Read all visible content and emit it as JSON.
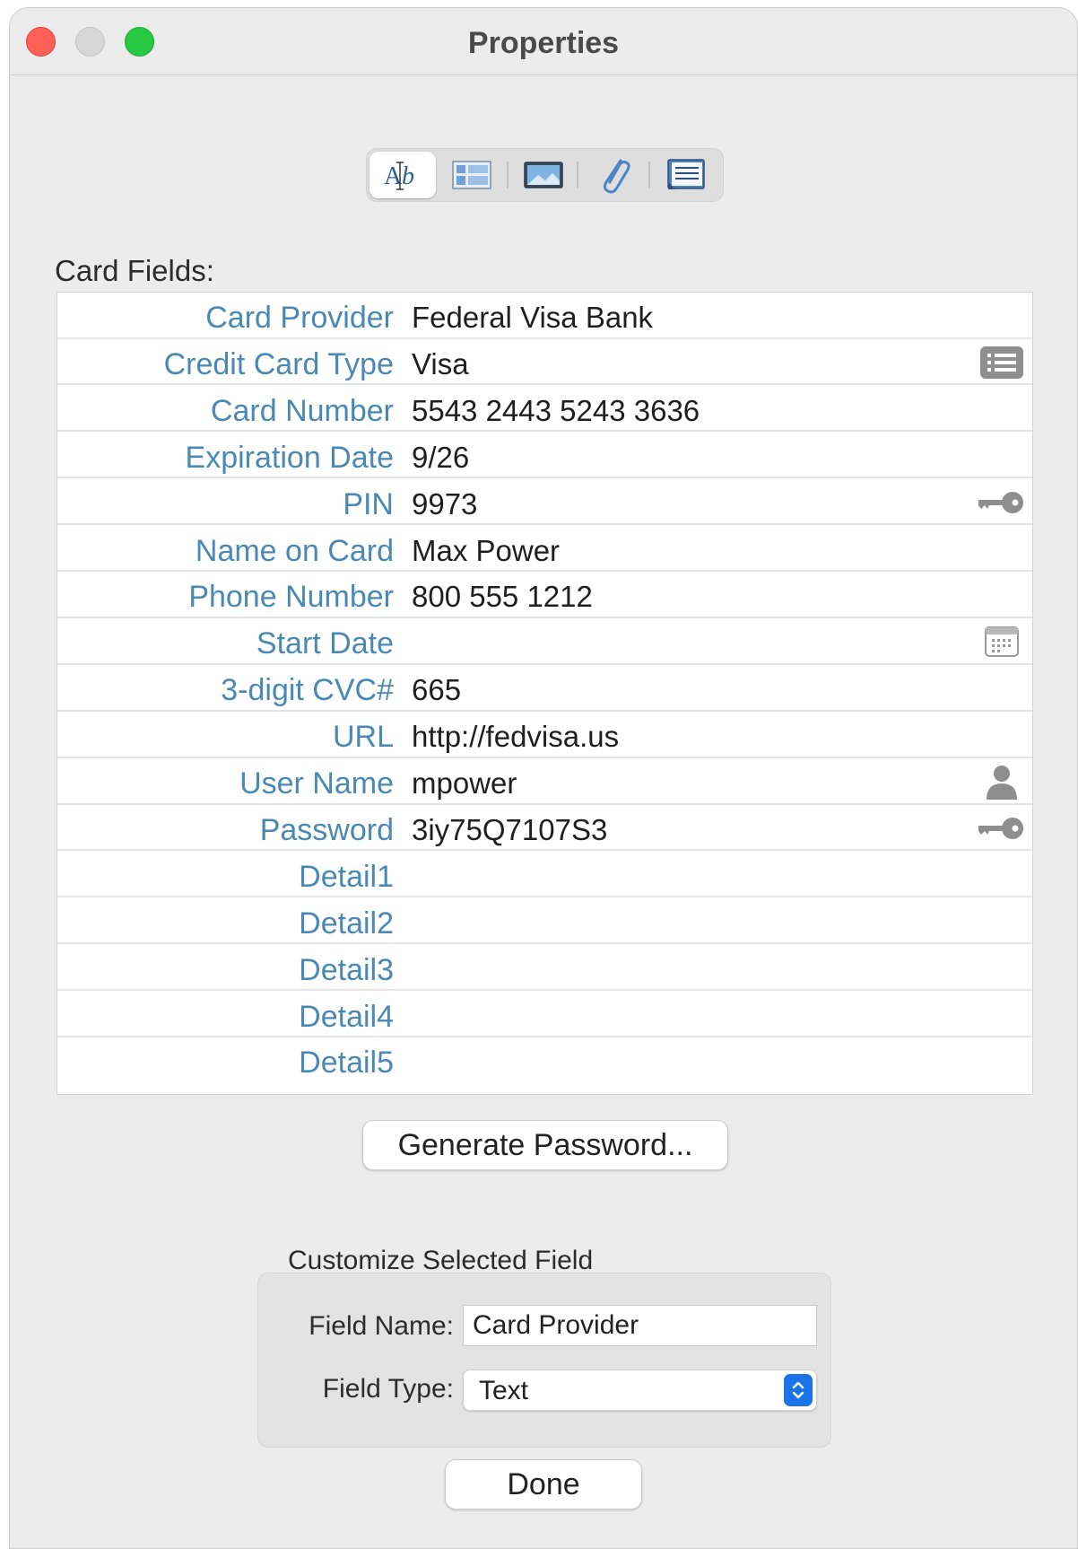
{
  "window": {
    "title": "Properties"
  },
  "section_label": "Card Fields:",
  "fields": [
    {
      "name": "Card Provider",
      "value": "Federal Visa Bank",
      "icon": ""
    },
    {
      "name": "Credit Card Type",
      "value": "Visa",
      "icon": "list-icon"
    },
    {
      "name": "Card Number",
      "value": "5543 2443 5243 3636",
      "icon": ""
    },
    {
      "name": "Expiration Date",
      "value": "9/26",
      "icon": ""
    },
    {
      "name": "PIN",
      "value": "9973",
      "icon": "key-icon"
    },
    {
      "name": "Name on Card",
      "value": "Max Power",
      "icon": ""
    },
    {
      "name": "Phone Number",
      "value": "800 555 1212",
      "icon": ""
    },
    {
      "name": "Start Date",
      "value": "",
      "icon": "calendar-icon"
    },
    {
      "name": "3-digit CVC#",
      "value": "665",
      "icon": ""
    },
    {
      "name": "URL",
      "value": "http://fedvisa.us",
      "icon": ""
    },
    {
      "name": "User Name",
      "value": "mpower",
      "icon": "person-icon"
    },
    {
      "name": "Password",
      "value": "3iy75Q7107S3",
      "icon": "key-icon"
    },
    {
      "name": "Detail1",
      "value": "",
      "icon": ""
    },
    {
      "name": "Detail2",
      "value": "",
      "icon": ""
    },
    {
      "name": "Detail3",
      "value": "",
      "icon": ""
    },
    {
      "name": "Detail4",
      "value": "",
      "icon": ""
    },
    {
      "name": "Detail5",
      "value": "",
      "icon": ""
    }
  ],
  "buttons": {
    "generate": "Generate Password...",
    "done": "Done"
  },
  "customize": {
    "title": "Customize Selected Field",
    "name_label": "Field Name:",
    "name_value": "Card Provider",
    "type_label": "Field Type:",
    "type_value": "Text"
  },
  "colors": {
    "field_name": "#4b89b5",
    "accent": "#1a74e8"
  }
}
